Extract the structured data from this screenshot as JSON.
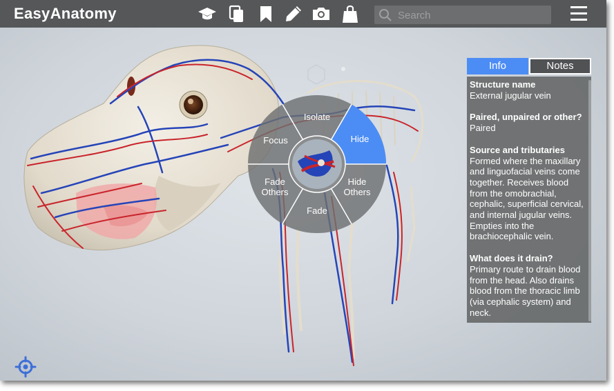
{
  "app": {
    "title": "EasyAnatomy"
  },
  "toolbar": {
    "icons": [
      "graduation-cap-icon",
      "copy-icon",
      "bookmark-icon",
      "pencil-icon",
      "camera-icon",
      "shopping-bag-icon"
    ],
    "search_placeholder": "Search",
    "menu_icon": "hamburger-menu-icon"
  },
  "radial_menu": {
    "items": [
      "Isolate",
      "Hide",
      "Hide Others",
      "Fade",
      "Fade Others",
      "Focus"
    ],
    "selected": "Hide",
    "highlight_color": "#4c8df5"
  },
  "info_panel": {
    "tabs": [
      "Info",
      "Notes"
    ],
    "active_tab": "Info",
    "sections": [
      {
        "heading": "Structure name",
        "text": "External jugular vein"
      },
      {
        "heading": "Paired, unpaired or other?",
        "text": "Paired"
      },
      {
        "heading": "Source and tributaries",
        "text": "Formed where the maxillary and linguofacial veins come together. Receives blood from the omobrachial, cephalic, superficial cervical, and internal jugular veins. Empties into the brachiocephalic vein."
      },
      {
        "heading": "What does it drain?",
        "text": "Primary route to drain blood from the head. Also drains blood from the thoracic limb (via cephalic system) and neck."
      }
    ]
  },
  "colors": {
    "topbar": "#555759",
    "accent": "#4c8df5",
    "artery": "#c9242b",
    "vein": "#2544b8",
    "bone": "#e8e2d4"
  }
}
